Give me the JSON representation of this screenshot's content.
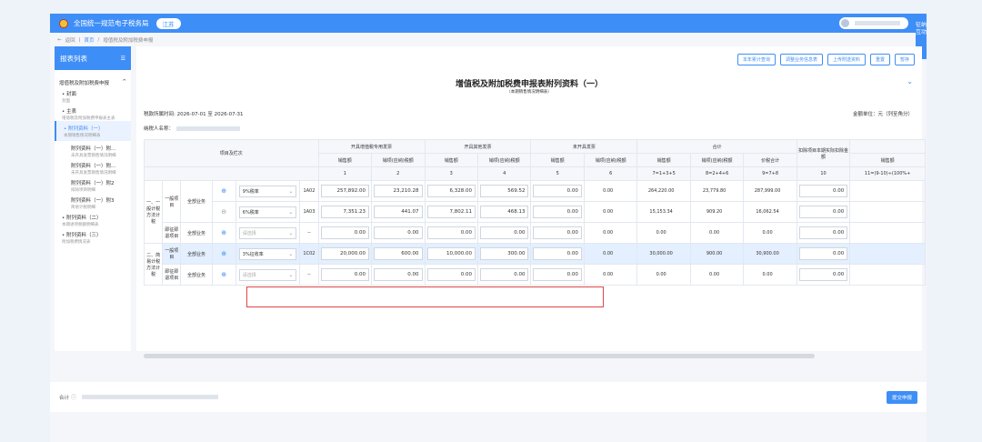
{
  "header": {
    "brand": "全国统一规范电子税务局",
    "province": "江苏",
    "help_tab": "征纳互动"
  },
  "breadcrumb": {
    "back": "返回",
    "home": "首页",
    "current": "增值税及附加税费申报"
  },
  "sidebar": {
    "title": "报表列表",
    "group": "增值税及附加税费申报",
    "items": [
      {
        "label": "• 封面",
        "sub": "封面"
      },
      {
        "label": "• 主表",
        "sub": "增值税及附加税费申报表主表"
      },
      {
        "label": "• 附列资料（一）",
        "sub": "本期销售情况明细表"
      },
      {
        "label": "附列资料（一）附...",
        "sub": "未开具发票销售情况明细"
      },
      {
        "label": "附列资料（一）附...",
        "sub": "未开具发票销售情况明细"
      },
      {
        "label": "附列资料（一）附2",
        "sub": "扣除项目明细"
      },
      {
        "label": "附列资料（一）附3",
        "sub": "简易计税明细"
      },
      {
        "label": "• 附列资料（二）",
        "sub": "本期进项税额明细表"
      },
      {
        "label": "• 附列资料（三）",
        "sub": "附加税费情况表"
      }
    ]
  },
  "actions": [
    "本年累计查询",
    "调整业务信息表",
    "上传附送资料",
    "重置",
    "暂存"
  ],
  "form": {
    "title": "增值税及附加税费申报表附列资料（一）",
    "subtitle": "（本期销售情况明细表）",
    "period_label": "税款所属时间:",
    "period_start": "2026-07-01",
    "period_to": "至",
    "period_end": "2026-07-31",
    "taxpayer_label": "纳税人名称：",
    "unit": "金额单位：元（列至角分）"
  },
  "table": {
    "item_col_header": "项目及栏次",
    "group_headers": [
      "开具增值税专用发票",
      "开具其他发票",
      "未开具发票",
      "合计",
      "扣除项目本期实际扣除金额"
    ],
    "sub_headers": [
      "销售额",
      "销项(应纳)税额",
      "销售额",
      "销项(应纳)税额",
      "销售额",
      "销项(应纳)税额",
      "销售额",
      "销项(应纳)税额",
      "价税合计",
      "",
      "销售额"
    ],
    "col_numbers": [
      "1",
      "2",
      "3",
      "4",
      "5",
      "6",
      "7=1+3+5",
      "8=2+4+6",
      "9=7+8",
      "10",
      "11=(9-10)÷(100%+"
    ],
    "sec1": "一、一般计税方法计税",
    "sec2": "二、简易计税方法计税",
    "general_item": "一般项目",
    "immediate_item": "即征即退项目",
    "biz": "全部业务",
    "select_placeholder": "请选择",
    "dash": "--",
    "rows": [
      {
        "rate": "9%税率",
        "code": "1A02",
        "c1": "257,892.00",
        "c2": "23,210.28",
        "c3": "6,328.00",
        "c4": "569.52",
        "c5": "0.00",
        "c6": "0.00",
        "c7": "264,220.00",
        "c8": "23,779.80",
        "c9": "287,999.00",
        "c10": "0.00"
      },
      {
        "rate": "6%税率",
        "code": "1A03",
        "c1": "7,351.23",
        "c2": "441.07",
        "c3": "7,802.11",
        "c4": "468.13",
        "c5": "0.00",
        "c6": "0.00",
        "c7": "15,153.34",
        "c8": "909.20",
        "c9": "16,062.54",
        "c10": "0.00"
      },
      {
        "c1": "0.00",
        "c2": "0.00",
        "c3": "0.00",
        "c4": "0.00",
        "c5": "0.00",
        "c6": "0.00",
        "c7": "0.00",
        "c8": "0.00",
        "c9": "0.00",
        "c10": "0.00"
      },
      {
        "rate": "3%征收率",
        "code": "1C02",
        "c1": "20,000.00",
        "c2": "600.00",
        "c3": "10,000.00",
        "c4": "300.00",
        "c5": "0.00",
        "c6": "0.00",
        "c7": "30,000.00",
        "c8": "900.00",
        "c9": "30,900.00",
        "c10": "0.00"
      },
      {
        "c1": "0.00",
        "c2": "0.00",
        "c3": "0.00",
        "c4": "0.00",
        "c5": "0.00",
        "c6": "0.00",
        "c7": "0.00",
        "c8": "0.00",
        "c9": "0.00",
        "c10": "0.00"
      }
    ]
  },
  "footer": {
    "total_label": "合计",
    "submit": "提交申报"
  }
}
